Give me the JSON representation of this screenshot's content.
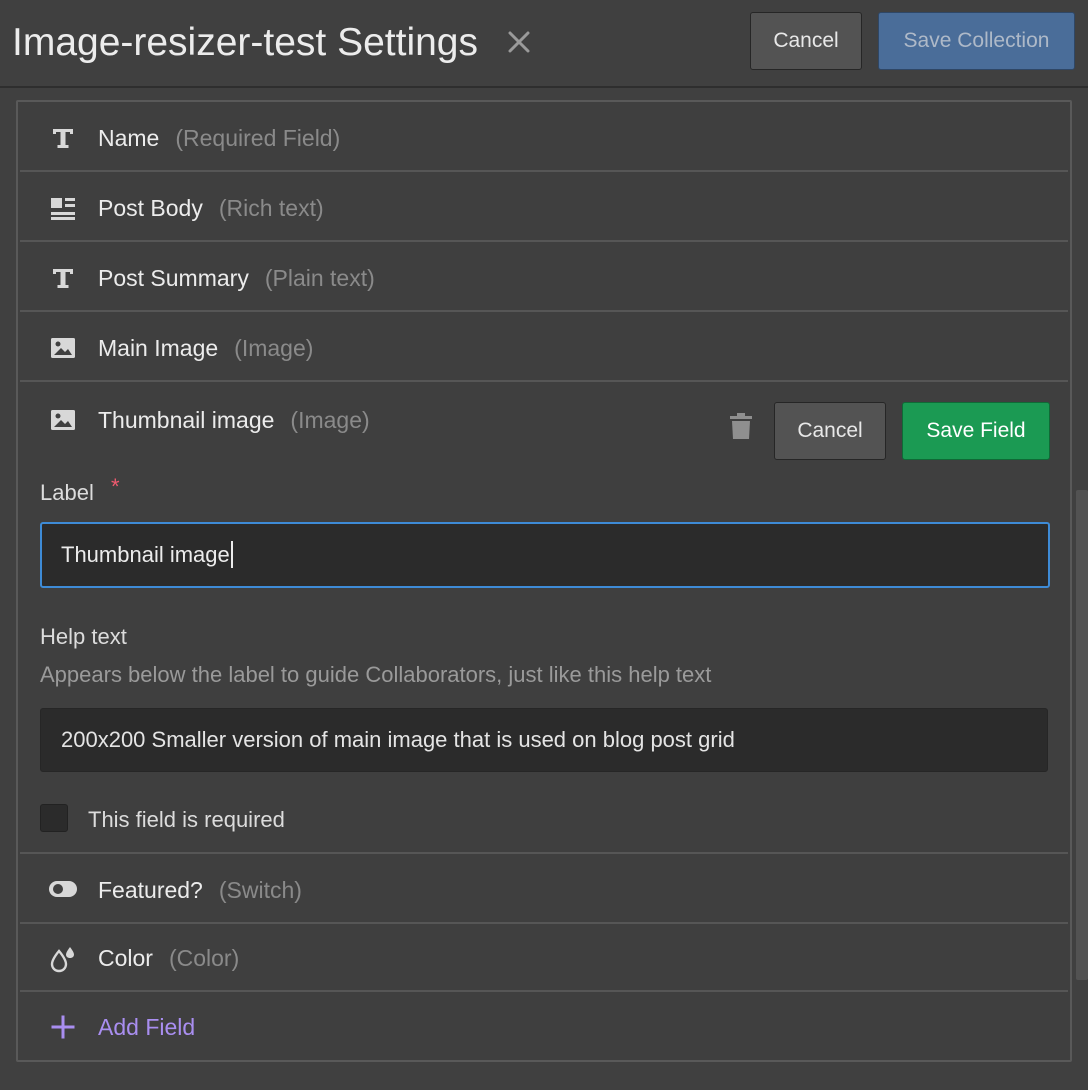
{
  "header": {
    "title": "Image-resizer-test Settings",
    "cancel_label": "Cancel",
    "save_label": "Save Collection"
  },
  "fields": [
    {
      "name": "Name",
      "type": "(Required Field)",
      "icon": "text-icon"
    },
    {
      "name": "Post Body",
      "type": "(Rich text)",
      "icon": "rich-text-icon"
    },
    {
      "name": "Post Summary",
      "type": "(Plain text)",
      "icon": "text-icon"
    },
    {
      "name": "Main Image",
      "type": "(Image)",
      "icon": "image-icon"
    }
  ],
  "editing": {
    "name": "Thumbnail image",
    "type": "(Image)",
    "icon": "image-icon",
    "cancel_label": "Cancel",
    "save_label": "Save Field",
    "label_caption": "Label",
    "required_star": "*",
    "label_value": "Thumbnail image",
    "help_caption": "Help text",
    "help_sub": "Appears below the label to guide Collaborators, just like this help text",
    "help_value": "200x200 Smaller version of main image that is used on blog post grid",
    "required_label": "This field is required"
  },
  "fields_after": [
    {
      "name": "Featured?",
      "type": "(Switch)",
      "icon": "switch-icon"
    },
    {
      "name": "Color",
      "type": "(Color)",
      "icon": "color-drop-icon"
    }
  ],
  "add_field_label": "Add Field",
  "colors": {
    "accent_blue": "#4a6d99",
    "save_green": "#1b9a53",
    "add_purple": "#a98ef0",
    "required_red": "#ef5a6f",
    "focus_blue": "#3e8bd6"
  }
}
